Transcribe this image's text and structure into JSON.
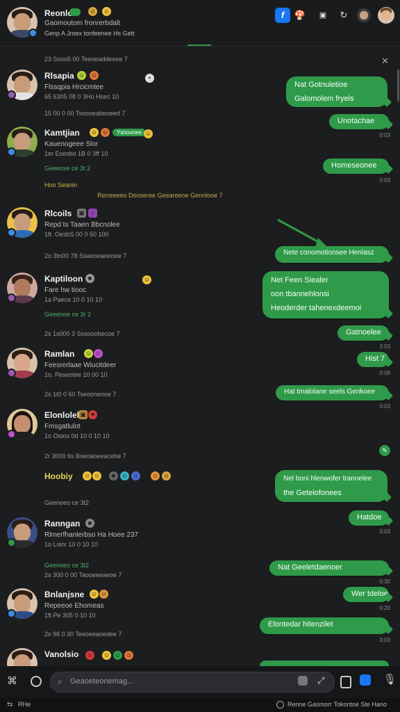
{
  "header": {
    "title": "Reonlo",
    "tag": "",
    "subtitle": "Gaomoutom fronrerbdalt",
    "subline": "Genp A Jroex  tonfeenee  Hs Gett",
    "icons": [
      "facebook-icon",
      "mushroom-icon",
      "square-icon",
      "refresh-icon",
      "user-icon",
      "profile-avatar"
    ]
  },
  "contacts": [
    {
      "name": "Rlsapia",
      "sub": "Flssqpia Hrcicmtee",
      "meta": "65  6305 08  0  3Ho  Hsec  10"
    },
    {
      "name": "Kamtjian",
      "sub": "Kauenogeee Slor",
      "meta": "1er  Esesbo  1B  0  3ff  10",
      "tag": "Ysnounee"
    },
    {
      "name": "Rlcoils",
      "sub": "Repd ts Taaen Bbcnolee",
      "meta": "1ft.  OesbS  00  0  50  100"
    },
    {
      "name": "Kaptiloon",
      "sub": "Fare hw tiooc",
      "meta": "1a  Paece  10  0  10  10"
    },
    {
      "name": "Ramlan",
      "sub": "Feesrerlaae  Wiucitdeer",
      "meta": "1o.  Peseotee  10  00  10"
    },
    {
      "name": "Elonlolel",
      "sub": "Fmsgatlulot",
      "meta": "1o  Ostos  0d  10  0  10  10"
    },
    {
      "name": "Hoobiy",
      "sub": "",
      "meta": ""
    },
    {
      "name": "Ranngan",
      "sub": "Rlmerfhanlerbso  Ha  Hoee  237",
      "meta": "1o  Lslnr  10  0  10  10"
    },
    {
      "name": "Bnlanjsne",
      "sub": "Repeeoe  Ehomeas",
      "meta": "1ft  Pe  305  0  10  10"
    },
    {
      "name": "Vanolsio",
      "sub": "",
      "meta": ""
    }
  ],
  "separators": [
    "23  Ssoo5  00   Teeoeaddeeee  7",
    "Geeeose ce 3t 2",
    "Hoo  Seanin",
    "15  00 0  00   Tsoooeabeoeed  7",
    "Geeenoe ce 3r 2",
    "2o  3tn00  78   Ssaooeaoeoee  7",
    "2s  1s000 3   Sssooobecoe  7",
    "2s  1t0 0  60   Tseooneooe  7",
    "2r  3000  6s   Bseoaoeeacebe  7",
    "Geenoeo ce 3t2",
    "2s  300 0  00   Taooeeeaeoe  7",
    "2s  98 0  30   Teeoeeaoedee  7"
  ],
  "links_row": "Rerreeeeo  Dooseree  Geeareeoe  Gennlooe  7",
  "bubbles": [
    {
      "lines": [
        "Nat                Gotnuletioe",
        "Galomolem fryels"
      ]
    },
    {
      "lines": [
        "Unotachae"
      ]
    },
    {
      "lines": [
        "Homeseonee"
      ]
    },
    {
      "lines": [
        "Nete  conomotionsee  Henlasz"
      ]
    },
    {
      "lines": [
        "Net                Feen Siealer",
        "oon  tbannehlonsi",
        "Heoderder  tahenexdeemoi"
      ]
    },
    {
      "lines": [
        "Gatnoelee"
      ]
    },
    {
      "lines": [
        "Hist 7"
      ]
    },
    {
      "lines": [
        "Hat tmalolane  seels  Genkoee"
      ]
    },
    {
      "lines": [
        "Nel  boni  hlenwofer  trannelee",
        "the  Getelofonees"
      ]
    },
    {
      "lines": [
        "Hatdoe"
      ]
    },
    {
      "lines": [
        "Nat                Geeletdaenoer"
      ]
    },
    {
      "lines": [
        "Wer  tdeloe"
      ]
    },
    {
      "lines": [
        "Elontedar  hitenzilet"
      ]
    }
  ],
  "bubble_times": [
    "0:03",
    "0:03",
    "3:03",
    "0:09",
    "0:03",
    "3:03",
    "0:30",
    "0:20",
    "3:03"
  ],
  "composer": {
    "placeholder": "Geaoeteonemag..."
  },
  "statusbar": {
    "left": "RHe",
    "right": "Renne Gasmorr  Tokontoe  Ste Hano"
  },
  "colors": {
    "accent": "#2f9a49",
    "background": "#1c1d1f",
    "header": "#1a1b1d"
  }
}
